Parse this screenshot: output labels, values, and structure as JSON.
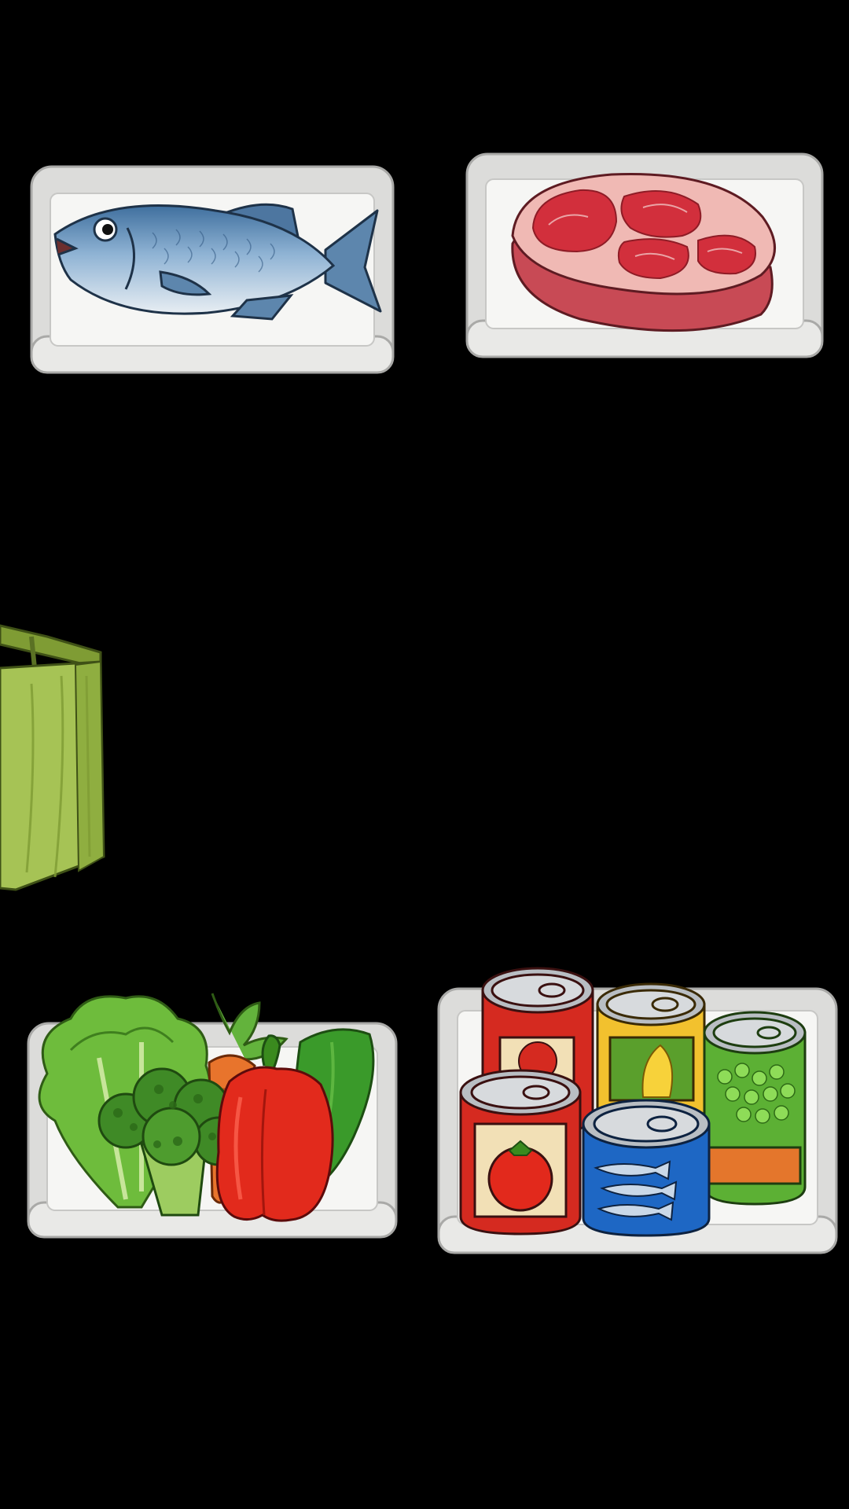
{
  "game": {
    "background_color": "#000000",
    "tray_color": "#f4f4f2",
    "bag_color": "#9cbc46",
    "trays": [
      {
        "item": "fish",
        "icon": "fish-icon"
      },
      {
        "item": "steak",
        "icon": "steak-icon"
      },
      {
        "item": "vegetables",
        "icon": "vegetables-icon"
      },
      {
        "item": "canned-goods",
        "icon": "canned-goods-icon"
      }
    ],
    "bag": {
      "icon": "shopping-bag-icon"
    }
  }
}
